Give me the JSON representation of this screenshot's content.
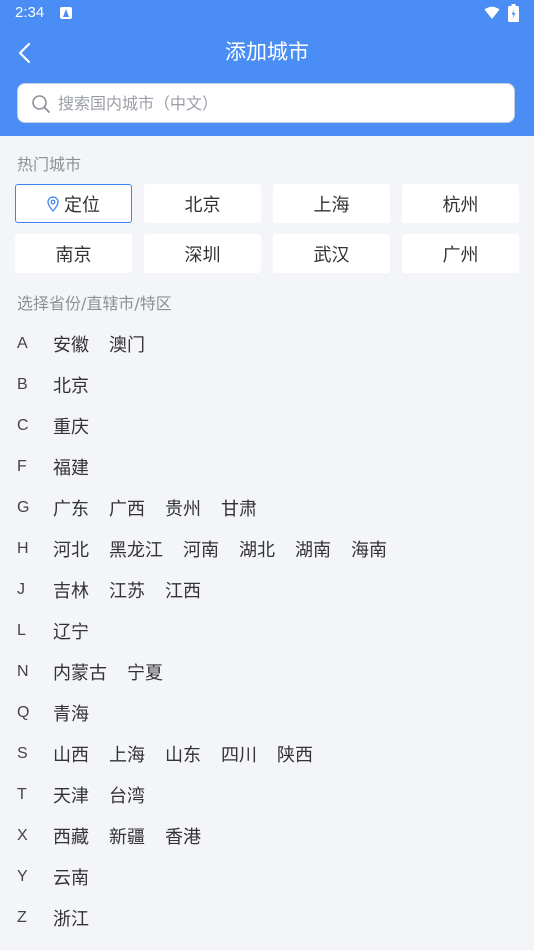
{
  "status": {
    "time": "2:34"
  },
  "header": {
    "title": "添加城市"
  },
  "search": {
    "placeholder": "搜索国内城市（中文）"
  },
  "hot": {
    "label": "热门城市",
    "cities": [
      "定位",
      "北京",
      "上海",
      "杭州",
      "南京",
      "深圳",
      "武汉",
      "广州"
    ]
  },
  "province": {
    "label": "选择省份/直辖市/特区"
  },
  "groups": [
    {
      "letter": "A",
      "cities": [
        "安徽",
        "澳门"
      ]
    },
    {
      "letter": "B",
      "cities": [
        "北京"
      ]
    },
    {
      "letter": "C",
      "cities": [
        "重庆"
      ]
    },
    {
      "letter": "F",
      "cities": [
        "福建"
      ]
    },
    {
      "letter": "G",
      "cities": [
        "广东",
        "广西",
        "贵州",
        "甘肃"
      ]
    },
    {
      "letter": "H",
      "cities": [
        "河北",
        "黑龙江",
        "河南",
        "湖北",
        "湖南",
        "海南"
      ]
    },
    {
      "letter": "J",
      "cities": [
        "吉林",
        "江苏",
        "江西"
      ]
    },
    {
      "letter": "L",
      "cities": [
        "辽宁"
      ]
    },
    {
      "letter": "N",
      "cities": [
        "内蒙古",
        "宁夏"
      ]
    },
    {
      "letter": "Q",
      "cities": [
        "青海"
      ]
    },
    {
      "letter": "S",
      "cities": [
        "山西",
        "上海",
        "山东",
        "四川",
        "陕西"
      ]
    },
    {
      "letter": "T",
      "cities": [
        "天津",
        "台湾"
      ]
    },
    {
      "letter": "X",
      "cities": [
        "西藏",
        "新疆",
        "香港"
      ]
    },
    {
      "letter": "Y",
      "cities": [
        "云南"
      ]
    },
    {
      "letter": "Z",
      "cities": [
        "浙江"
      ]
    }
  ],
  "colors": {
    "accent": "#4a8ef5",
    "background": "#f3f5f8",
    "locate_border": "#3e84f1"
  }
}
